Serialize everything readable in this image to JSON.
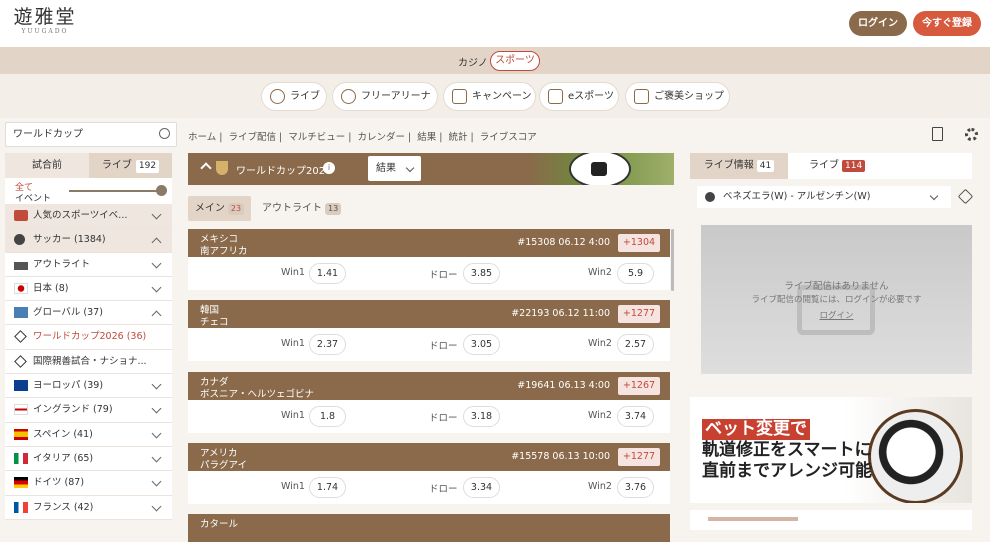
{
  "brand": {
    "kanji": "遊雅堂",
    "sub": "YUUGADO"
  },
  "auth": {
    "login": "ログイン",
    "register": "今すぐ登録"
  },
  "modes": {
    "casino": "カジノ",
    "sports": "スポーツ"
  },
  "categories": [
    {
      "label": "ライブ",
      "icon": "clock-icon"
    },
    {
      "label": "フリーアリーナ",
      "icon": "fast-icon"
    },
    {
      "label": "キャンペーン",
      "icon": "megaphone-icon"
    },
    {
      "label": "eスポーツ",
      "icon": "gamepad-icon"
    },
    {
      "label": "ご褒美ショップ",
      "icon": "shop-icon"
    }
  ],
  "search": {
    "placeholder": "ワールドカップ"
  },
  "lefttabs": {
    "prematch": "試合前",
    "live": "ライブ",
    "live_count": "192"
  },
  "allevents": {
    "line1": "全て",
    "line2": "イベント"
  },
  "leftlist": [
    {
      "label": "人気のスポーツイベ...",
      "icon": "popular-icon",
      "chev": "down",
      "hl": true
    },
    {
      "label": "サッカー (1384)",
      "icon": "soccer-ball-icon",
      "chev": "up",
      "hl": true
    },
    {
      "label": "アウトライト",
      "icon": "podium-icon",
      "chev": "down"
    },
    {
      "label": "日本 (8)",
      "icon": "japan-flag-icon",
      "chev": "down"
    },
    {
      "label": "グローバル (37)",
      "icon": "globe-icon",
      "chev": "up"
    },
    {
      "label": "ワールドカップ2026 (36)",
      "icon": "star-icon",
      "active": true
    },
    {
      "label": "国際親善試合・ナショナ...",
      "icon": "star-icon"
    },
    {
      "label": "ヨーロッパ (39)",
      "icon": "eu-flag-icon",
      "chev": "down"
    },
    {
      "label": "イングランド (79)",
      "icon": "england-flag-icon",
      "chev": "down"
    },
    {
      "label": "スペイン (41)",
      "icon": "spain-flag-icon",
      "chev": "down"
    },
    {
      "label": "イタリア (65)",
      "icon": "italy-flag-icon",
      "chev": "down"
    },
    {
      "label": "ドイツ (87)",
      "icon": "germany-flag-icon",
      "chev": "down"
    },
    {
      "label": "フランス (42)",
      "icon": "france-flag-icon",
      "chev": "down"
    }
  ],
  "crumbs": [
    "ホーム",
    "|",
    "ライブ配信",
    "|",
    "マルチビュー",
    "|",
    "カレンダー",
    "|",
    "結果",
    "|",
    "統計",
    "|",
    "ライブスコア"
  ],
  "banner": {
    "title": "ワールドカップ2026",
    "select": "結果"
  },
  "subtabs": {
    "main": "メイン",
    "main_count": "23",
    "outright": "アウトライト",
    "outright_count": "13"
  },
  "matches": [
    {
      "home": "メキシコ",
      "away": "南アフリカ",
      "meta": "#15308  06.12  4:00",
      "more": "+1304",
      "win1": "1.41",
      "draw": "3.85",
      "win2": "5.9"
    },
    {
      "home": "韓国",
      "away": "チェコ",
      "meta": "#22193  06.12  11:00",
      "more": "+1277",
      "win1": "2.37",
      "draw": "3.05",
      "win2": "2.57"
    },
    {
      "home": "カナダ",
      "away": "ボスニア・ヘルツェゴビナ",
      "meta": "#19641  06.13  4:00",
      "more": "+1267",
      "win1": "1.8",
      "draw": "3.18",
      "win2": "3.74"
    },
    {
      "home": "アメリカ",
      "away": "パラグアイ",
      "meta": "#15578  06.13  10:00",
      "more": "+1277",
      "win1": "1.74",
      "draw": "3.34",
      "win2": "3.76"
    },
    {
      "home": "カタール",
      "away": "",
      "meta": "",
      "more": "",
      "win1": "",
      "draw": "",
      "win2": ""
    }
  ],
  "odds_labels": {
    "win1": "Win1",
    "draw": "ドロー",
    "win2": "Win2"
  },
  "right": {
    "info": "ライブ情報",
    "info_count": "41",
    "live": "ライブ",
    "live_count": "114",
    "match": "ベネズエラ(W) - アルゼンチン(W)"
  },
  "stream": {
    "t1": "ライブ配信はありません",
    "t2": "ライブ配信の閲覧には、ログインが必要です",
    "t3": "ログイン"
  },
  "promo": {
    "l1": "ベット変更で",
    "l2": "軌道修正をスマートに",
    "l3": "直前までアレンジ可能"
  },
  "colors": {
    "brown": "#8a6a4a",
    "accent": "#c04a3c",
    "register": "#d75a3e"
  }
}
